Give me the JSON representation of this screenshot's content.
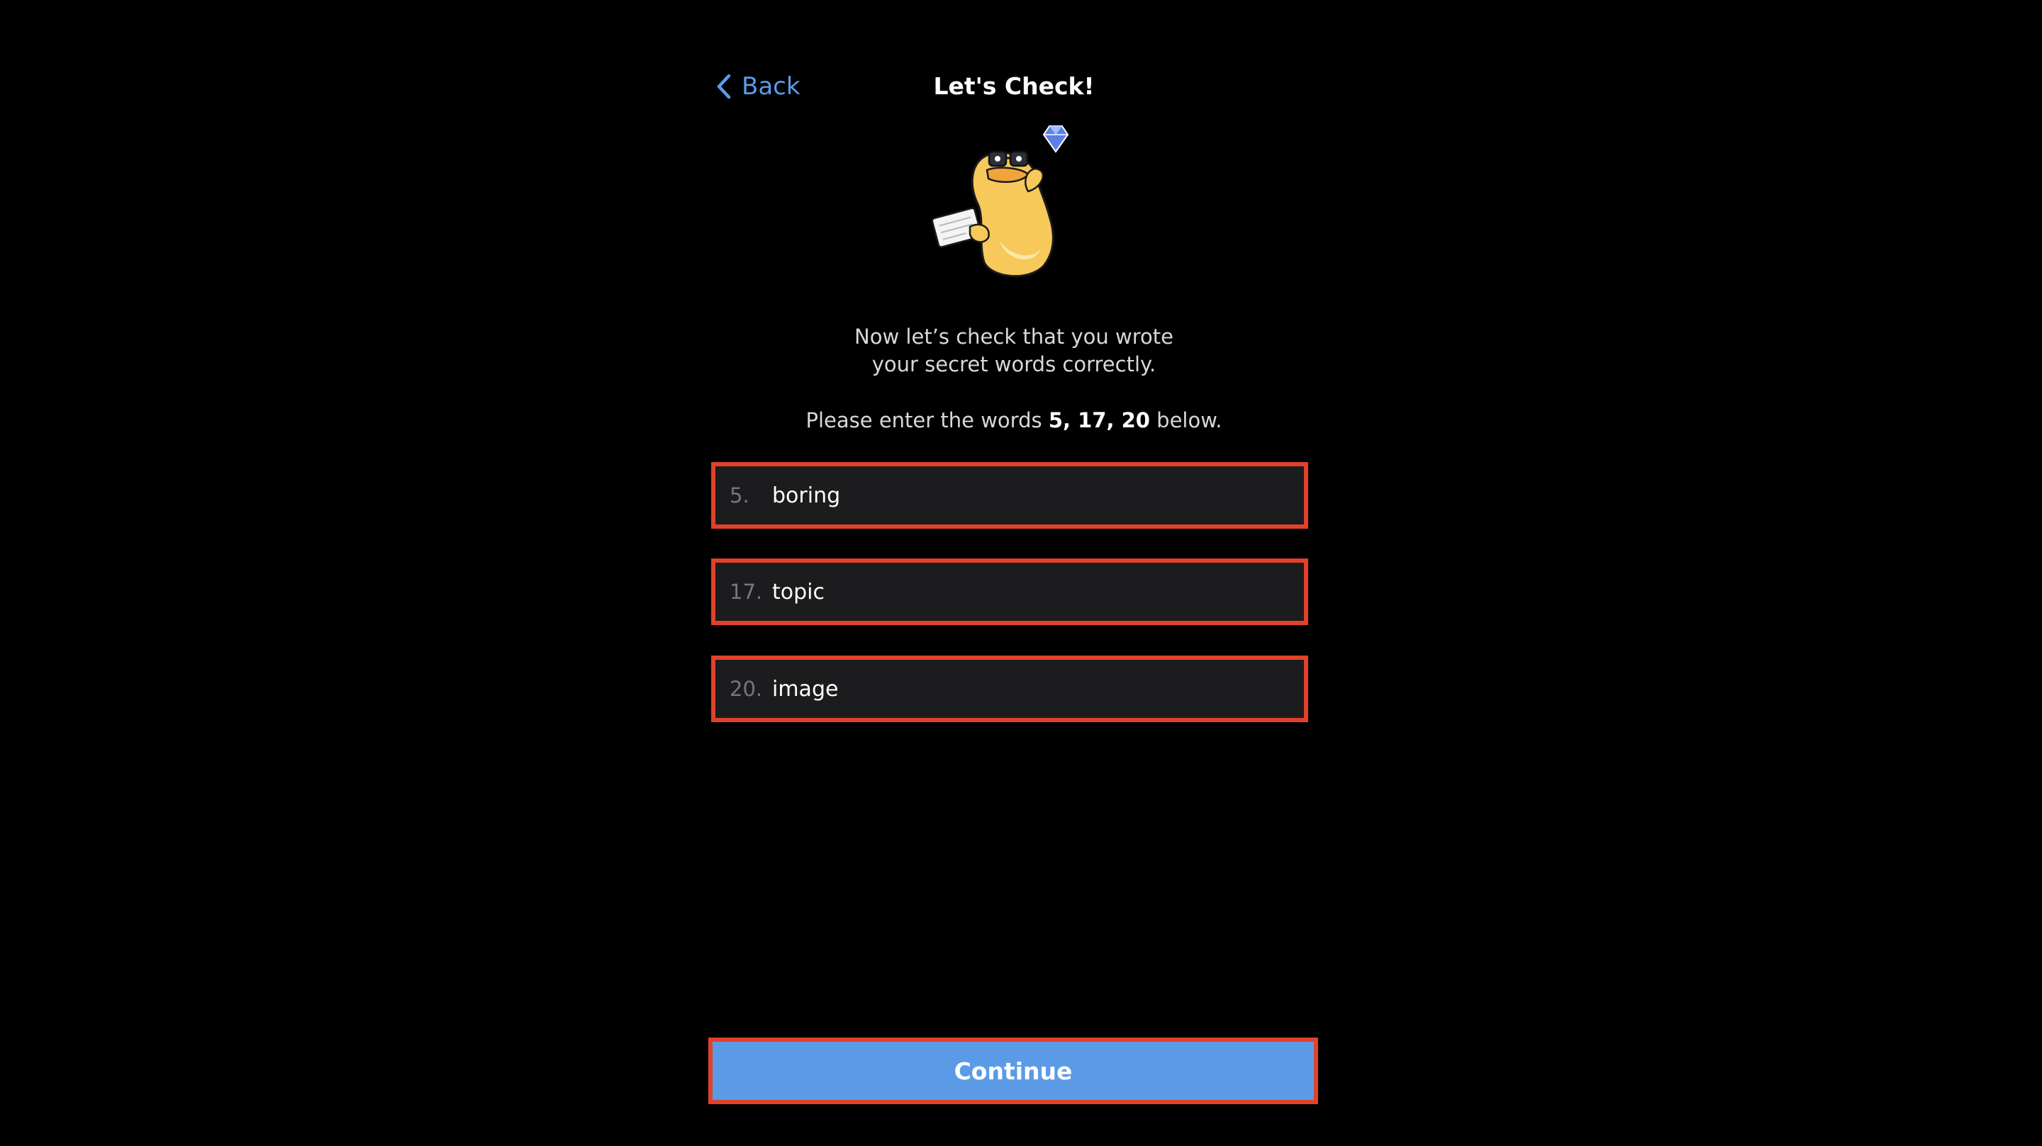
{
  "header": {
    "back_label": "Back",
    "title": "Let's Check!"
  },
  "intro": {
    "line1": "Now let’s check that you wrote",
    "line2": "your secret words correctly."
  },
  "instruction": {
    "prefix": "Please enter the words ",
    "word_numbers": "5, 17, 20",
    "suffix": " below."
  },
  "words": [
    {
      "number": "5.",
      "value": "boring"
    },
    {
      "number": "17.",
      "value": "topic"
    },
    {
      "number": "20.",
      "value": "image"
    }
  ],
  "continue_label": "Continue",
  "icons": {
    "back": "chevron-left-icon",
    "mascot": "duck-mascot-icon",
    "gem": "diamond-icon"
  },
  "colors": {
    "background": "#000000",
    "accent": "#5b9be6",
    "field_background": "#1c1c1e",
    "highlight_border": "#e2412a"
  }
}
